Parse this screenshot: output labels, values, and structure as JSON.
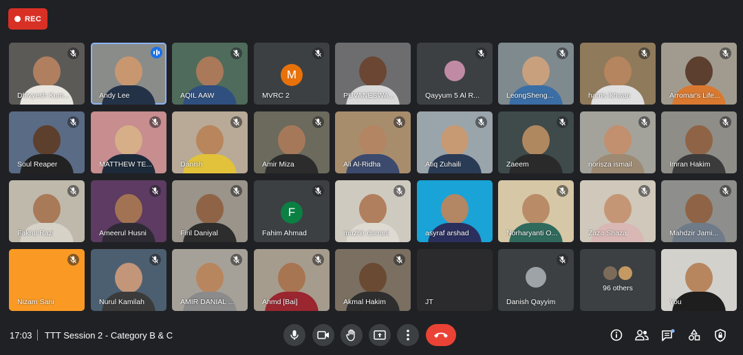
{
  "recording": {
    "label": "REC",
    "color": "#d93025"
  },
  "accent": {
    "active_border": "#8ab4f8",
    "speaking": "#1a73e8",
    "end_call": "#ea4335"
  },
  "participants": [
    {
      "name": "Dhivyesh Kum...",
      "muted": true,
      "style": "video",
      "bg": "#5b5a57",
      "skin": "#b07f5f",
      "shirt": "#e9e6df"
    },
    {
      "name": "Andy Lee",
      "muted": false,
      "speaking": true,
      "active": true,
      "style": "video",
      "bg": "#8a8c8a",
      "skin": "#c9976f",
      "shirt": "#243247"
    },
    {
      "name": "AQIL AAW",
      "muted": true,
      "style": "video",
      "bg": "#4f6b5b",
      "skin": "#a9795a",
      "shirt": "#2f4f7f"
    },
    {
      "name": "MVRC 2",
      "muted": true,
      "style": "letter",
      "letter": "M",
      "letter_color": "#e8710a"
    },
    {
      "name": "PUVANESWA...",
      "muted": false,
      "style": "video",
      "bg": "#6d6d70",
      "skin": "#6b4632",
      "shirt": "#d9d9d9"
    },
    {
      "name": "Qayyum 5 Al R...",
      "muted": true,
      "style": "avatar",
      "avatar_color": "#c08aa5"
    },
    {
      "name": "LeongSheng...",
      "muted": true,
      "style": "video",
      "bg": "#7f8a8f",
      "skin": "#c9a07d",
      "shirt": "#3a6ea5"
    },
    {
      "name": "harris ikhwan",
      "muted": true,
      "style": "video",
      "bg": "#8f7a5b",
      "skin": "#b5855f",
      "shirt": "#e0e0e0"
    },
    {
      "name": "Arromar's Life...",
      "muted": true,
      "style": "video",
      "bg": "#a19b8f",
      "skin": "#5c3f2e",
      "shirt": "#d97930"
    },
    {
      "name": "Soul Reaper",
      "muted": true,
      "style": "video",
      "bg": "#5a6b86",
      "skin": "#5d3f2d",
      "shirt": "#222222"
    },
    {
      "name": "MATTHEW TE...",
      "muted": true,
      "style": "video",
      "bg": "#c78d8f",
      "skin": "#d6ae88",
      "shirt": "#1d2a3a"
    },
    {
      "name": "Danish",
      "muted": true,
      "style": "video",
      "bg": "#b8aa97",
      "skin": "#b8855c",
      "shirt": "#e2c23a"
    },
    {
      "name": "Amir Miza",
      "muted": true,
      "style": "video",
      "bg": "#6b6a5d",
      "skin": "#a6785a",
      "shirt": "#2c2c2c"
    },
    {
      "name": "Ali Al-Ridha",
      "muted": true,
      "style": "video",
      "bg": "#a88d6d",
      "skin": "#b38562",
      "shirt": "#3c4a6e"
    },
    {
      "name": "Atiq Zuhaili",
      "muted": true,
      "style": "video",
      "bg": "#9aa4ab",
      "skin": "#c79a74",
      "shirt": "#2a3b55"
    },
    {
      "name": "Zaeem",
      "muted": true,
      "style": "video",
      "bg": "#3f4a4a",
      "skin": "#b08860",
      "shirt": "#2a2a2a"
    },
    {
      "name": "norisza ismail",
      "muted": true,
      "style": "video",
      "bg": "#a3a39b",
      "skin": "#c28f6f",
      "shirt": "#9d8a73"
    },
    {
      "name": "Imran Hakim",
      "muted": true,
      "style": "video",
      "bg": "#8e8d88",
      "skin": "#8f6446",
      "shirt": "#3b3b3b"
    },
    {
      "name": "Fakrul Razi",
      "muted": true,
      "style": "video",
      "bg": "#bfb9ac",
      "skin": "#a87a58",
      "shirt": "#d6d2c8"
    },
    {
      "name": "Ameerul Husni",
      "muted": true,
      "style": "video",
      "bg": "#5d3b62",
      "skin": "#a27353",
      "shirt": "#2d2a33"
    },
    {
      "name": "Firil Daniyal",
      "muted": true,
      "style": "video",
      "bg": "#9a948a",
      "skin": "#8f6446",
      "shirt": "#2d2d2d"
    },
    {
      "name": "Fahim Ahmad",
      "muted": true,
      "style": "letter",
      "letter": "F",
      "letter_color": "#0b8043"
    },
    {
      "name": "muzhir durrani",
      "muted": true,
      "style": "video",
      "bg": "#cfcac0",
      "skin": "#b07f5d",
      "shirt": "#dedad2"
    },
    {
      "name": "asyraf arshad",
      "muted": false,
      "style": "video",
      "bg": "#1aa3d6",
      "skin": "#b38664",
      "shirt": "#2b2f5e"
    },
    {
      "name": "Norharyanti O...",
      "muted": true,
      "style": "video",
      "bg": "#d6c7a6",
      "skin": "#b98b67",
      "shirt": "#2f6a5d"
    },
    {
      "name": "Zaza Shaza",
      "muted": true,
      "style": "video",
      "bg": "#cfc8bb",
      "skin": "#c59675",
      "shirt": "#d9b7b4"
    },
    {
      "name": "Mahdzir Jami...",
      "muted": true,
      "style": "video",
      "bg": "#8e8f8c",
      "skin": "#8f6446",
      "shirt": "#6f7b88"
    },
    {
      "name": "Nizam Sani",
      "muted": true,
      "style": "solid",
      "bg": "#fa9a24"
    },
    {
      "name": "Nurul Kamilah",
      "muted": true,
      "style": "video",
      "bg": "#4c5f70",
      "skin": "#c3967a",
      "shirt": "#3b3b3b"
    },
    {
      "name": "AMIR DANIAL ...",
      "muted": true,
      "style": "video",
      "bg": "#a6a198",
      "skin": "#b8865e",
      "shirt": "#8b8b8b"
    },
    {
      "name": "Ahmd [Bai]",
      "muted": true,
      "style": "video",
      "bg": "#a69c8d",
      "skin": "#a77551",
      "shirt": "#9a2630"
    },
    {
      "name": "Akmal Hakim",
      "muted": true,
      "style": "video",
      "bg": "#7a6f60",
      "skin": "#6a4a33",
      "shirt": "#2e2e2e"
    },
    {
      "name": "JT",
      "muted": false,
      "style": "solid",
      "bg": "#2b2b2e"
    },
    {
      "name": "Danish Qayyim",
      "muted": true,
      "style": "avatar",
      "avatar_color": "#9ea3a8"
    },
    {
      "name": "96 others",
      "muted": false,
      "style": "others"
    },
    {
      "name": "You",
      "muted": false,
      "style": "video",
      "bg": "#d3d1cc",
      "skin": "#b7865f",
      "shirt": "#1e1e1e"
    }
  ],
  "bottom_bar": {
    "time": "17:03",
    "separator": "|",
    "meeting_title": "TTT Session 2 - Category B & C"
  },
  "controls": {
    "center": [
      {
        "id": "mic",
        "icon": "microphone-icon"
      },
      {
        "id": "camera",
        "icon": "camera-icon"
      },
      {
        "id": "raise-hand",
        "icon": "hand-icon"
      },
      {
        "id": "present",
        "icon": "present-screen-icon"
      },
      {
        "id": "more",
        "icon": "more-vert-icon"
      },
      {
        "id": "leave",
        "icon": "end-call-icon"
      }
    ],
    "right": [
      {
        "id": "info",
        "icon": "info-icon"
      },
      {
        "id": "people",
        "icon": "people-icon"
      },
      {
        "id": "chat",
        "icon": "chat-icon"
      },
      {
        "id": "activities",
        "icon": "activities-icon"
      },
      {
        "id": "host-controls",
        "icon": "shield-lock-icon"
      }
    ]
  }
}
